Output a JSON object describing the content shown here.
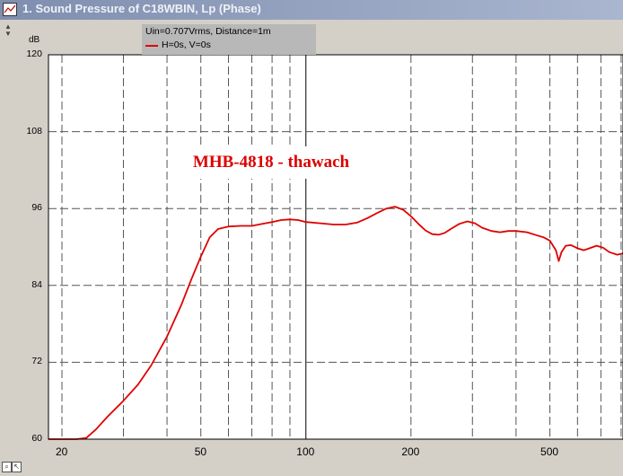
{
  "window": {
    "title": "1. Sound Pressure of C18WBIN, Lp (Phase)",
    "icon": "chart-window-icon"
  },
  "legend": {
    "info": "Uin=0.707Vrms, Distance=1m",
    "series_label": "H=0s, V=0s"
  },
  "watermark": "MHB-4818 - thawach",
  "chart_data": {
    "type": "line",
    "title": "",
    "xlabel": "",
    "ylabel": "dB",
    "x_scale": "log",
    "xlim": [
      18.3,
      810
    ],
    "ylim": [
      60,
      120
    ],
    "y_ticks": [
      "60",
      "72",
      "84",
      "96",
      "108",
      "120"
    ],
    "x_ticks": [
      "20",
      "50",
      "100",
      "200",
      "500"
    ],
    "grid": true,
    "background": "#ffffff",
    "series": [
      {
        "name": "H=0s, V=0s",
        "color": "#e00000",
        "points": [
          [
            18.3,
            60.0
          ],
          [
            20,
            60.0
          ],
          [
            22,
            60.0
          ],
          [
            23.5,
            60.2
          ],
          [
            25,
            61.5
          ],
          [
            27,
            63.5
          ],
          [
            30,
            66.0
          ],
          [
            33,
            68.5
          ],
          [
            36,
            71.5
          ],
          [
            40,
            76.0
          ],
          [
            44,
            81.0
          ],
          [
            47,
            85.0
          ],
          [
            50,
            88.5
          ],
          [
            53,
            91.5
          ],
          [
            56,
            92.8
          ],
          [
            60,
            93.2
          ],
          [
            65,
            93.3
          ],
          [
            70,
            93.3
          ],
          [
            75,
            93.6
          ],
          [
            80,
            93.9
          ],
          [
            85,
            94.2
          ],
          [
            90,
            94.3
          ],
          [
            95,
            94.2
          ],
          [
            100,
            93.9
          ],
          [
            110,
            93.7
          ],
          [
            120,
            93.5
          ],
          [
            130,
            93.5
          ],
          [
            140,
            93.8
          ],
          [
            150,
            94.5
          ],
          [
            160,
            95.3
          ],
          [
            170,
            96.0
          ],
          [
            180,
            96.3
          ],
          [
            190,
            95.8
          ],
          [
            200,
            94.8
          ],
          [
            210,
            93.6
          ],
          [
            220,
            92.6
          ],
          [
            230,
            92.0
          ],
          [
            240,
            91.9
          ],
          [
            250,
            92.2
          ],
          [
            260,
            92.8
          ],
          [
            275,
            93.6
          ],
          [
            290,
            94.0
          ],
          [
            305,
            93.7
          ],
          [
            320,
            93.0
          ],
          [
            340,
            92.5
          ],
          [
            360,
            92.3
          ],
          [
            380,
            92.5
          ],
          [
            400,
            92.5
          ],
          [
            430,
            92.3
          ],
          [
            460,
            91.8
          ],
          [
            480,
            91.5
          ],
          [
            500,
            91.0
          ],
          [
            520,
            89.5
          ],
          [
            530,
            87.8
          ],
          [
            540,
            89.2
          ],
          [
            555,
            90.2
          ],
          [
            575,
            90.3
          ],
          [
            600,
            89.8
          ],
          [
            625,
            89.5
          ],
          [
            650,
            89.8
          ],
          [
            680,
            90.2
          ],
          [
            710,
            89.9
          ],
          [
            740,
            89.2
          ],
          [
            780,
            88.8
          ],
          [
            810,
            89.0
          ]
        ]
      }
    ]
  }
}
